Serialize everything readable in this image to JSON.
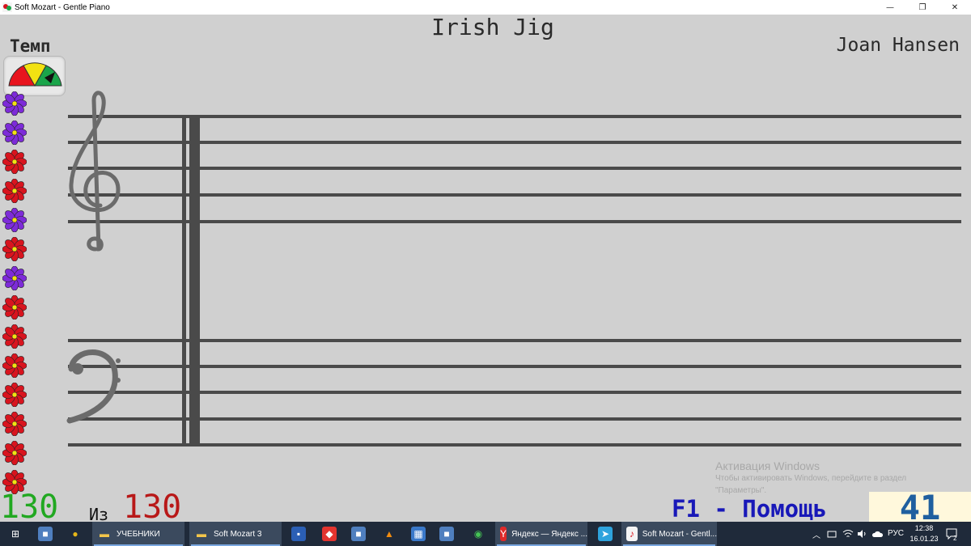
{
  "window": {
    "title": "Soft Mozart - Gentle Piano",
    "minimize_glyph": "—",
    "restore_glyph": "❐",
    "close_glyph": "✕"
  },
  "song": {
    "title": "Irish Jig",
    "composer": "Joan Hansen"
  },
  "tempo": {
    "label": "Темп",
    "colors": [
      "#e8141e",
      "#f2e112",
      "#1aa54a"
    ]
  },
  "flowers": [
    "purple",
    "purple",
    "red",
    "red",
    "purple",
    "red",
    "purple",
    "red",
    "red",
    "red",
    "red",
    "red",
    "red",
    "red"
  ],
  "flower_colors": {
    "red": "#d8141e",
    "purple": "#7d2bd8"
  },
  "counter": {
    "done": "130",
    "of_label": "Из",
    "total": "130"
  },
  "help": "F1 - Помощь",
  "score": "41",
  "activation": {
    "title": "Активация Windows",
    "line1": "Чтобы активировать Windows, перейдите в раздел",
    "line2": "\"Параметры\"."
  },
  "taskbar": {
    "items": [
      {
        "name": "start",
        "icon": "windows-icon",
        "label": ""
      },
      {
        "name": "app-1",
        "icon": "app-icon",
        "label": ""
      },
      {
        "name": "chrome",
        "icon": "chrome-icon",
        "label": ""
      },
      {
        "name": "folder-textbooks",
        "icon": "folder-icon",
        "label": "УЧЕБНИКИ"
      },
      {
        "name": "folder-softmozart3",
        "icon": "folder-icon",
        "label": "Soft Mozart 3"
      },
      {
        "name": "save",
        "icon": "floppy-icon",
        "label": ""
      },
      {
        "name": "anydesk",
        "icon": "anydesk-icon",
        "label": ""
      },
      {
        "name": "app-2",
        "icon": "app-icon",
        "label": ""
      },
      {
        "name": "vlc",
        "icon": "vlc-icon",
        "label": ""
      },
      {
        "name": "calculator",
        "icon": "calculator-icon",
        "label": ""
      },
      {
        "name": "app-3",
        "icon": "app-icon",
        "label": ""
      },
      {
        "name": "whatsapp",
        "icon": "whatsapp-icon",
        "label": ""
      },
      {
        "name": "yandex",
        "icon": "yandex-icon",
        "label": "Яндекс — Яндекс ..."
      },
      {
        "name": "telegram",
        "icon": "telegram-icon",
        "label": ""
      },
      {
        "name": "soft-mozart",
        "icon": "soft-mozart-icon",
        "label": "Soft Mozart - Gentl..."
      }
    ],
    "tray": {
      "language": "РУС",
      "time": "12:38",
      "date": "16.01.23",
      "notifications": "2"
    }
  }
}
